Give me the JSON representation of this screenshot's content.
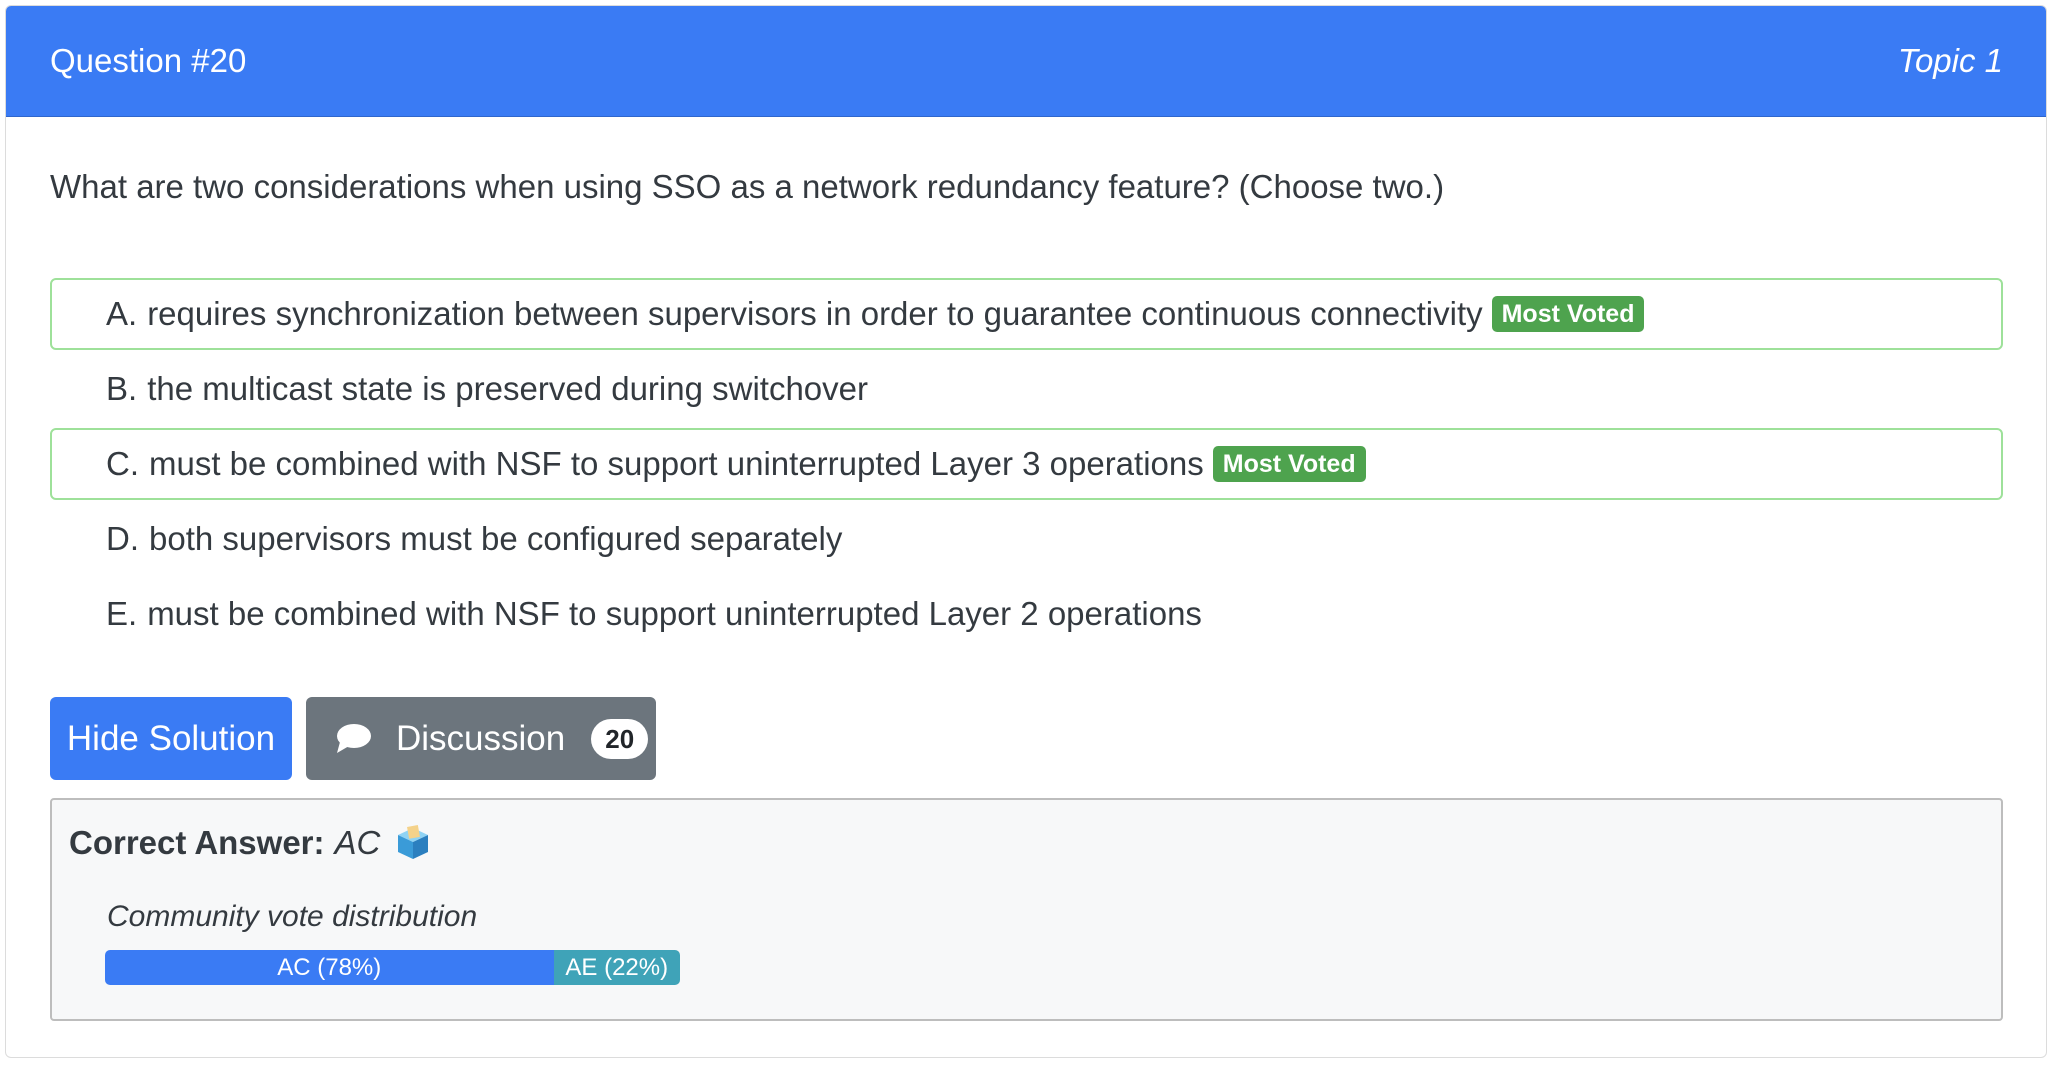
{
  "header": {
    "title": "Question #20",
    "topic": "Topic 1"
  },
  "question": {
    "text": "What are two considerations when using SSO as a network redundancy feature? (Choose two.)"
  },
  "choices": [
    {
      "letter": "A.",
      "text": "requires synchronization between supervisors in order to guarantee continuous connectivity",
      "badge": "Most Voted"
    },
    {
      "letter": "B.",
      "text": "the multicast state is preserved during switchover",
      "badge": ""
    },
    {
      "letter": "C.",
      "text": "must be combined with NSF to support uninterrupted Layer 3 operations",
      "badge": "Most Voted"
    },
    {
      "letter": "D.",
      "text": "both supervisors must be configured separately",
      "badge": ""
    },
    {
      "letter": "E.",
      "text": "must be combined with NSF to support uninterrupted Layer 2 operations",
      "badge": ""
    }
  ],
  "actions": {
    "hide_solution_label": "Hide Solution",
    "discussion_label": "Discussion",
    "discussion_count": "20"
  },
  "answer": {
    "label": "Correct Answer:",
    "value": "AC",
    "icon": "ballot-box-icon",
    "distribution_label": "Community vote distribution",
    "votes": [
      {
        "label": "AC (78%)",
        "percent": 78,
        "color": "#3a7bf4"
      },
      {
        "label": "AE (22%)",
        "percent": 22,
        "color": "#3fa3b8"
      }
    ]
  },
  "colors": {
    "primary": "#3a7bf4",
    "most_voted_badge": "#4ea34e",
    "voted_border": "#9ee19a",
    "secondary_button": "#6c757d"
  }
}
